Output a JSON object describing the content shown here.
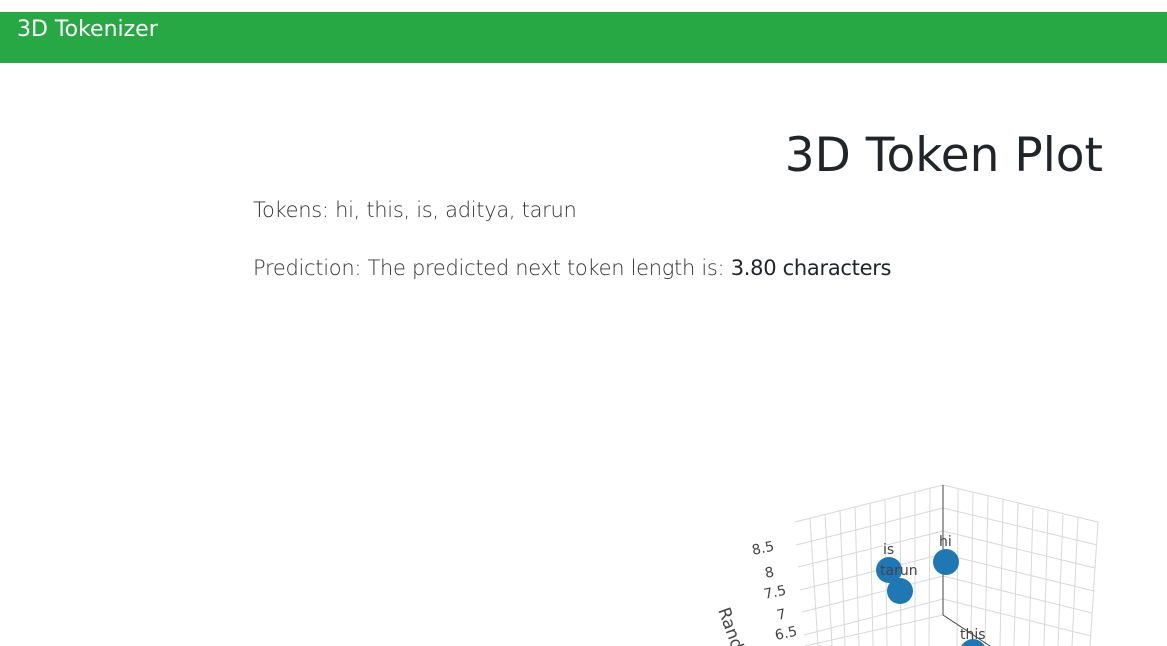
{
  "navbar": {
    "brand": "3D Tokenizer"
  },
  "page": {
    "title": "3D Token Plot",
    "tokens_label": "Tokens:",
    "tokens_text": "hi, this, is, aditya, tarun",
    "prediction_label": "Prediction: The predicted next token length is:",
    "prediction_value": "3.80 characters"
  },
  "colors": {
    "navbar": "#28a745",
    "marker": "#1f77b4"
  },
  "plot": {
    "axis_title_partial": "Rand",
    "ticks": [
      "8.5",
      "8",
      "7.5",
      "7",
      "6.5"
    ],
    "points": [
      {
        "label": "is"
      },
      {
        "label": "tarun"
      },
      {
        "label": "hi"
      },
      {
        "label": "this"
      }
    ]
  }
}
